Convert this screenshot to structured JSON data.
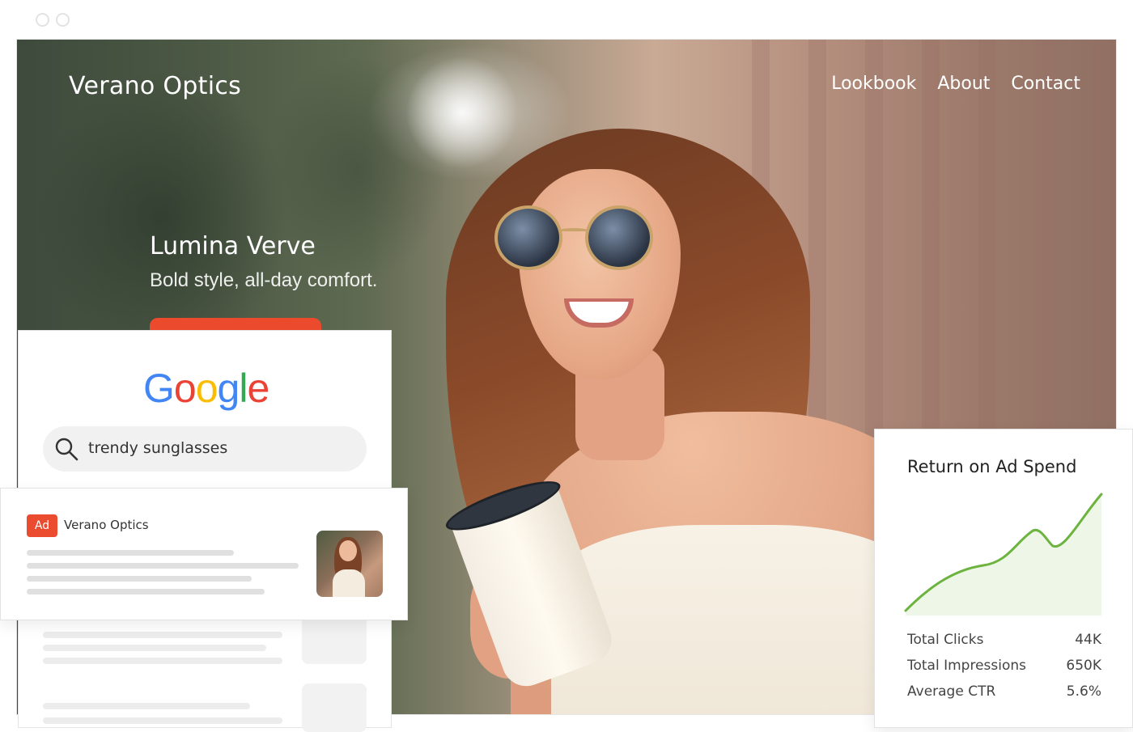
{
  "site": {
    "brand": "Verano Optics",
    "nav": [
      "Lookbook",
      "About",
      "Contact"
    ],
    "headline": "Lumina Verve",
    "subline": "Bold style, all-day comfort."
  },
  "google_card": {
    "logo": [
      "G",
      "o",
      "o",
      "g",
      "l",
      "e"
    ],
    "logo_colors": [
      "#4285F4",
      "#EA4335",
      "#FBBC05",
      "#4285F4",
      "#34A853",
      "#EA4335"
    ],
    "search_query": "trendy sunglasses"
  },
  "ad_card": {
    "badge": "Ad",
    "advertiser": "Verano Optics"
  },
  "roas_card": {
    "title": "Return on Ad Spend",
    "metrics": [
      {
        "label": "Total Clicks",
        "value": "44K"
      },
      {
        "label": "Total Impressions",
        "value": "650K"
      },
      {
        "label": "Average CTR",
        "value": "5.6%"
      }
    ],
    "line_color": "#6cb33f"
  }
}
